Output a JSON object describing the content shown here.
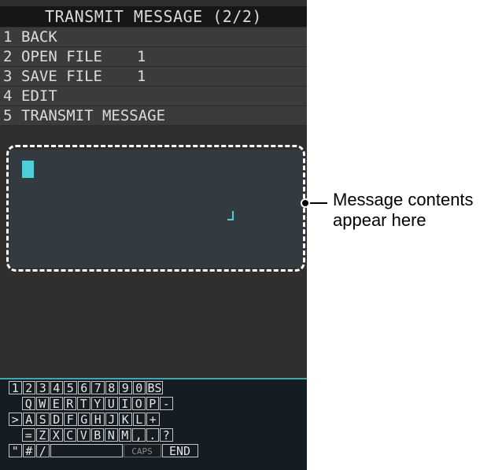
{
  "title": "TRANSMIT MESSAGE (2/2)",
  "menu": [
    {
      "num": "1",
      "label": "BACK",
      "value": ""
    },
    {
      "num": "2",
      "label": "OPEN FILE",
      "value": "1"
    },
    {
      "num": "3",
      "label": "SAVE FILE",
      "value": "1"
    },
    {
      "num": "4",
      "label": "EDIT",
      "value": ""
    },
    {
      "num": "5",
      "label": "TRANSMIT MESSAGE",
      "value": ""
    }
  ],
  "keyboard": {
    "row1": [
      "1",
      "2",
      "3",
      "4",
      "5",
      "6",
      "7",
      "8",
      "9",
      "0",
      "BS"
    ],
    "row2": [
      "Q",
      "W",
      "E",
      "R",
      "T",
      "Y",
      "U",
      "I",
      "O",
      "P",
      "-"
    ],
    "row3": [
      ">",
      "A",
      "S",
      "D",
      "F",
      "G",
      "H",
      "J",
      "K",
      "L",
      "+"
    ],
    "row4": [
      "=",
      "Z",
      "X",
      "C",
      "V",
      "B",
      "N",
      "M",
      ",",
      ".",
      "?"
    ],
    "row5": [
      "\"",
      "#",
      "/",
      "",
      "CAPS",
      "END"
    ]
  },
  "annotation": {
    "line1": "Message contents",
    "line2": "appear here"
  },
  "colors": {
    "screen_bg": "#2f2f2f",
    "cursor": "#4fd0d6",
    "keyboard_bg": "#151c22"
  }
}
